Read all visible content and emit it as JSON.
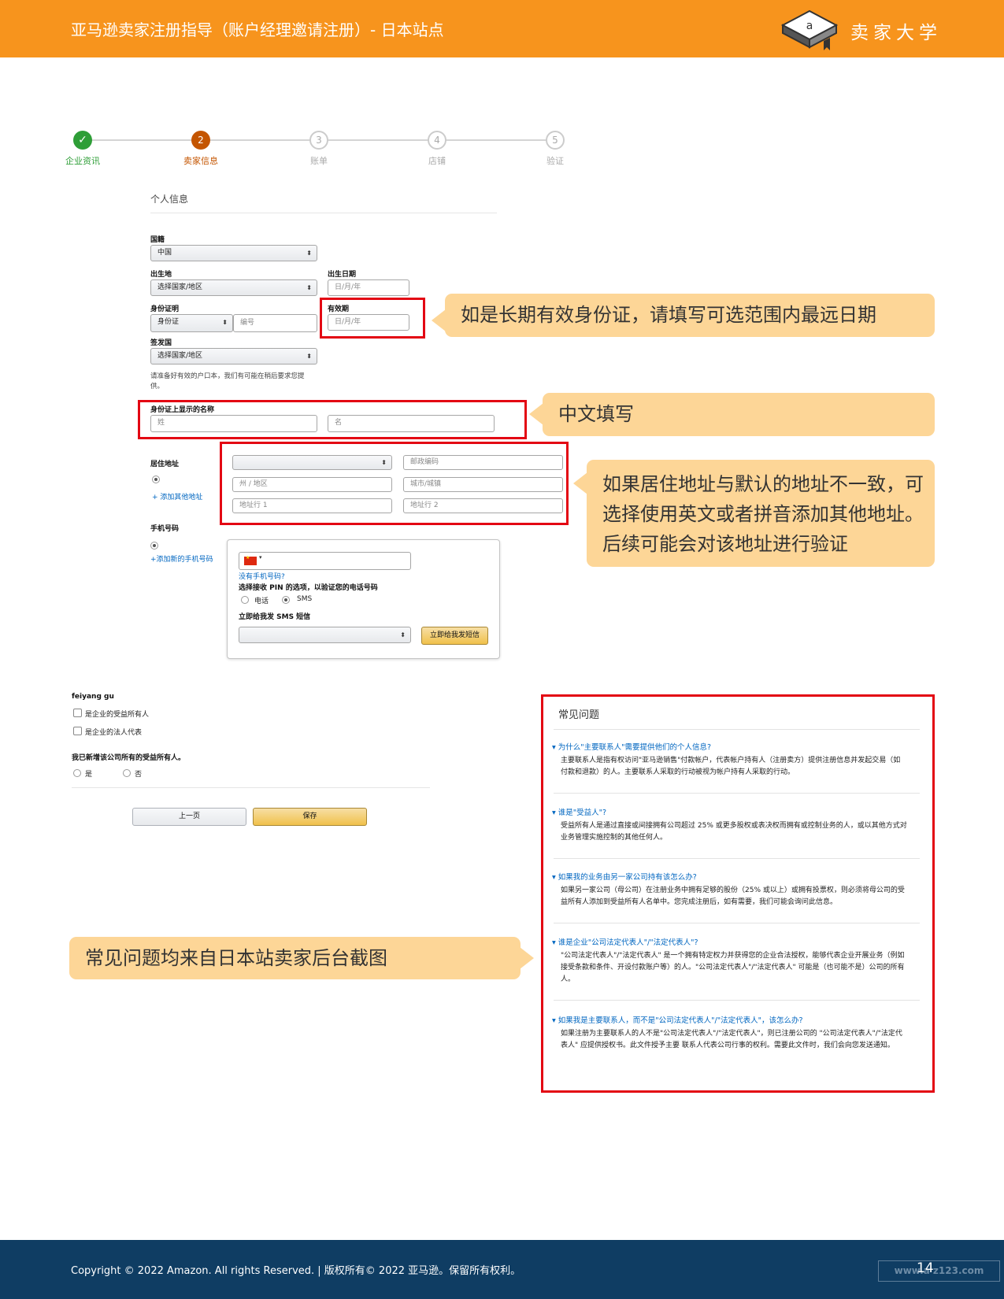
{
  "header": {
    "title": "亚马逊卖家注册指导（账户经理邀请注册）- 日本站点",
    "logo_text": "卖家大学"
  },
  "stepper": {
    "steps": [
      {
        "num": "✓",
        "label": "企业资讯"
      },
      {
        "num": "2",
        "label": "卖家信息"
      },
      {
        "num": "3",
        "label": "账单"
      },
      {
        "num": "4",
        "label": "店铺"
      },
      {
        "num": "5",
        "label": "验证"
      }
    ]
  },
  "form": {
    "section_title": "个人信息",
    "nationality": {
      "label": "国籍",
      "value": "中国"
    },
    "birthplace": {
      "label": "出生地",
      "value": "选择国家/地区"
    },
    "birthdate": {
      "label": "出生日期",
      "placeholder": "日/月/年"
    },
    "id_proof": {
      "label": "身份证明",
      "type": "身份证",
      "number_placeholder": "编号"
    },
    "expiry": {
      "label": "有效期",
      "placeholder": "日/月/年"
    },
    "issuer": {
      "label": "签发国",
      "value": "选择国家/地区"
    },
    "hint": "请准备好有效的户口本，我们有可能在稍后要求您提供。",
    "name_on_id": {
      "label": "身份证上显示的名称",
      "last_placeholder": "姓",
      "first_placeholder": "名"
    },
    "address": {
      "label": "居住地址",
      "add_link": "+ 添加其他地址",
      "postcode": "邮政编码",
      "state": "州 / 地区",
      "city": "城市/城镇",
      "line1": "地址行 1",
      "line2": "地址行 2"
    },
    "phone": {
      "label": "手机号码",
      "add_link": "+添加新的手机号码",
      "no_phone": "没有手机号码?",
      "pin_label": "选择接收 PIN 的选项，以验证您的电话号码",
      "opt_call": "电话",
      "opt_sms": "SMS",
      "send_label": "立即给我发 SMS 短信",
      "send_button": "立即给我发短信"
    },
    "person_name": "feiyang gu",
    "chk_owner": "是企业的受益所有人",
    "chk_legal": "是企业的法人代表",
    "question": "我已新增该公司所有的受益所有人。",
    "yes": "是",
    "no": "否",
    "prev_button": "上一页",
    "save_button": "保存"
  },
  "callouts": {
    "expiry": "如是长期有效身份证，请填写可选范围内最远日期",
    "name": "中文填写",
    "address": "如果居住地址与默认的地址不一致，可选择使用英文或者拼音添加其他地址。后续可能会对该地址进行验证",
    "faq": "常见问题均来自日本站卖家后台截图"
  },
  "faq": {
    "title": "常见问题",
    "items": [
      {
        "q": "为什么\"主要联系人\"需要提供他们的个人信息?",
        "a": "主要联系人是指有权访问\"亚马逊销售\"付款帐户，代表帐户持有人（注册卖方）提供注册信息并发起交易（如付款和退款）的人。主要联系人采取的行动被视为帐户持有人采取的行动。"
      },
      {
        "q": "谁是\"受益人\"?",
        "a": "受益所有人是通过直接或间接拥有公司超过 25% 或更多股权或表决权而拥有或控制业务的人，或以其他方式对业务管理实施控制的其他任何人。"
      },
      {
        "q": "如果我的业务由另一家公司持有该怎么办?",
        "a": "如果另一家公司（母公司）在注册业务中拥有足够的股份（25% 或以上）或拥有投票权，则必须将母公司的受益所有人添加到受益所有人名单中。您完成注册后，如有需要，我们可能会询问此信息。"
      },
      {
        "q": "谁是企业\"公司法定代表人\"/\"法定代表人\"?",
        "a": "\"公司法定代表人\"/\"法定代表人\" 是一个拥有特定权力并获得您的企业合法授权，能够代表企业开展业务（例如接受条款和条件、开设付款账户等）的人。\"公司法定代表人\"/\"法定代表人\" 可能是（也可能不是）公司的所有人。"
      },
      {
        "q": "如果我是主要联系人，而不是\"公司法定代表人\"/\"法定代表人\"，该怎么办?",
        "a": "如果注册为主要联系人的人不是\"公司法定代表人\"/\"法定代表人\"，则已注册公司的 \"公司法定代表人\"/\"法定代表人\" 应提供授权书。此文件授予主要 联系人代表公司行事的权利。需要此文件时，我们会向您发送通知。"
      }
    ]
  },
  "footer": {
    "copyright": "Copyright © 2022 Amazon. All rights Reserved. | 版权所有© 2022 亚马逊。保留所有权利。",
    "page": "14",
    "watermark": "www.a  z123.com"
  },
  "colors": {
    "header": "#f7941d",
    "footer": "#0f3d63",
    "callout": "#fdd697",
    "highlight": "#e30613"
  }
}
